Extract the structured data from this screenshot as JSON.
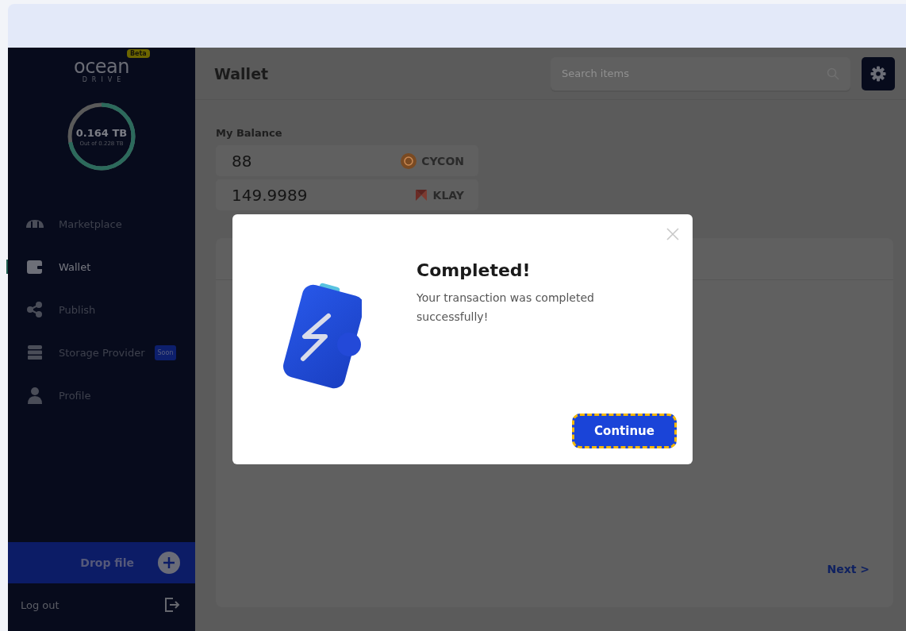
{
  "sidebar": {
    "logo": {
      "name": "ocean",
      "subtitle": "DRIVE",
      "badge": "Beta"
    },
    "storage": {
      "used": "0.164 TB",
      "total": "Out of 0.228 TB",
      "level": 0.72
    },
    "items": [
      {
        "label": "Marketplace",
        "selected": false
      },
      {
        "label": "Wallet",
        "selected": true
      },
      {
        "label": "Publish",
        "selected": false
      },
      {
        "label": "Storage Provider",
        "selected": false,
        "badge": "Soon"
      },
      {
        "label": "Profile",
        "selected": false
      }
    ],
    "drop_file": "Drop file",
    "logout": "Log out"
  },
  "header": {
    "title": "Wallet",
    "search": {
      "placeholder": "Search items"
    }
  },
  "balance": {
    "label": "My Balance",
    "rows": [
      {
        "amount": "88",
        "currency": "CYCON"
      },
      {
        "amount": "149.9989",
        "currency": "KLAY"
      }
    ]
  },
  "panel": {
    "next": "Next >"
  },
  "modal": {
    "title": "Completed!",
    "message": "Your transaction was completed successfully!",
    "button": "Continue"
  }
}
